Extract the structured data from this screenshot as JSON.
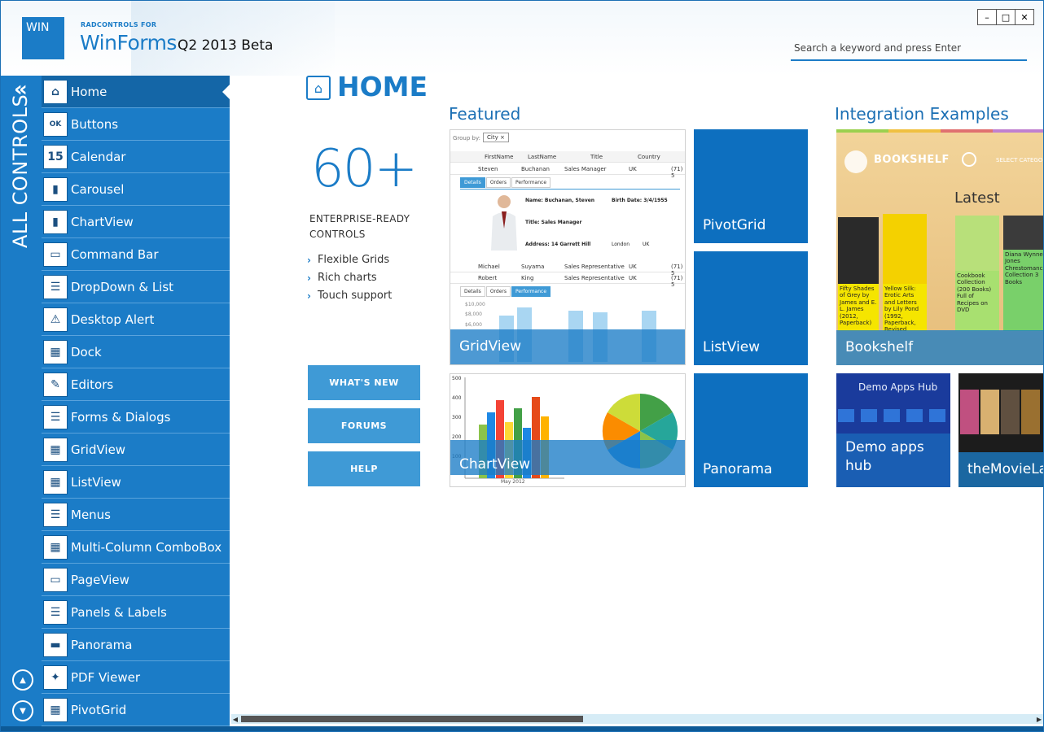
{
  "header": {
    "logo_text": "WIN",
    "brand_small": "RADCONTROLS FOR",
    "brand_product": "WinForms",
    "brand_version": "Q2 2013 Beta",
    "search_placeholder": "Search a keyword and press Enter",
    "window_buttons": {
      "minimize": "–",
      "maximize": "□",
      "close": "✕"
    }
  },
  "left_strip": {
    "collapse_glyph": "«",
    "vertical_label": "ALL CONTROLS",
    "scroll_up_glyph": "▲",
    "scroll_down_glyph": "▼"
  },
  "sidebar": {
    "items": [
      {
        "label": "Home",
        "icon": "home-icon",
        "glyph": "⌂",
        "active": true
      },
      {
        "label": "Buttons",
        "icon": "ok-button-icon",
        "glyph": "OK"
      },
      {
        "label": "Calendar",
        "icon": "calendar-icon",
        "glyph": "15"
      },
      {
        "label": "Carousel",
        "icon": "carousel-icon",
        "glyph": "▮"
      },
      {
        "label": "ChartView",
        "icon": "chart-icon",
        "glyph": "▮"
      },
      {
        "label": "Command Bar",
        "icon": "command-bar-icon",
        "glyph": "▭"
      },
      {
        "label": "DropDown & List",
        "icon": "dropdown-list-icon",
        "glyph": "☰"
      },
      {
        "label": "Desktop Alert",
        "icon": "alert-icon",
        "glyph": "⚠"
      },
      {
        "label": "Dock",
        "icon": "dock-icon",
        "glyph": "▦"
      },
      {
        "label": "Editors",
        "icon": "pencil-icon",
        "glyph": "✎"
      },
      {
        "label": "Forms & Dialogs",
        "icon": "form-icon",
        "glyph": "☰"
      },
      {
        "label": "GridView",
        "icon": "grid-icon",
        "glyph": "▦"
      },
      {
        "label": "ListView",
        "icon": "list-view-icon",
        "glyph": "▦"
      },
      {
        "label": "Menus",
        "icon": "menu-icon",
        "glyph": "☰"
      },
      {
        "label": "Multi-Column ComboBox",
        "icon": "combobox-icon",
        "glyph": "▦"
      },
      {
        "label": "PageView",
        "icon": "page-view-icon",
        "glyph": "▭"
      },
      {
        "label": "Panels & Labels",
        "icon": "panels-icon",
        "glyph": "☰"
      },
      {
        "label": "Panorama",
        "icon": "panorama-icon",
        "glyph": "▬"
      },
      {
        "label": "PDF Viewer",
        "icon": "pdf-icon",
        "glyph": "✦"
      },
      {
        "label": "PivotGrid",
        "icon": "pivot-grid-icon",
        "glyph": "▦"
      }
    ]
  },
  "main": {
    "title": "HOME",
    "big_number": "60+",
    "subhead_line1": "ENTERPRISE-READY",
    "subhead_line2": "CONTROLS",
    "features": [
      "Flexible Grids",
      "Rich charts",
      "Touch support"
    ],
    "feature_glyph": "›",
    "buttons": [
      "WHAT'S NEW",
      "FORUMS",
      "HELP"
    ],
    "featured_title": "Featured",
    "integration_title": "Integration Examples",
    "tiles": {
      "gridview": "GridView",
      "pivotgrid": "PivotGrid",
      "listview": "ListView",
      "chartview": "ChartView",
      "panorama": "Panorama",
      "bookshelf": "Bookshelf",
      "demo_apps": "Demo apps hub",
      "movielab": "theMovieLab"
    }
  },
  "grid_preview": {
    "group_by": "Group by:",
    "chip": "City ×",
    "headers": [
      "FirstName",
      "LastName",
      "Title",
      "Country"
    ],
    "row1": [
      "Steven",
      "Buchanan",
      "Sales Manager",
      "UK",
      "(71) 5"
    ],
    "tabs": [
      "Details",
      "Orders",
      "Performance"
    ],
    "detail_name": "Name: Buchanan, Steven",
    "detail_birth": "Birth Date: 3/4/1955",
    "detail_title": "Title: Sales Manager",
    "detail_address": "Address: 14 Garrett Hill",
    "detail_city": "London",
    "detail_country": "UK",
    "row2": [
      "Michael",
      "Suyama",
      "Sales Representative",
      "UK",
      "(71) 5"
    ],
    "row3": [
      "Robert",
      "King",
      "Sales Representative",
      "UK",
      "(71) 5"
    ],
    "chart_ticks": [
      "$10,000",
      "$8,000",
      "$6,000"
    ]
  },
  "chart_preview": {
    "y_ticks": [
      "500",
      "400",
      "300",
      "200",
      "100"
    ],
    "x_label": "May 2012"
  },
  "bookshelf_preview": {
    "name": "BOOKSHELF",
    "category": "SELECT CATEGORY",
    "latest": "Latest",
    "books": [
      "Fifty Shades of Grey by James and E. L. James (2012, Paperback)",
      "Yellow Silk: Erotic Arts and Letters by Lily Pond (1992, Paperback, Revised",
      "Cookbook Collection (200 Books) Full of Recipes on DVD",
      "Diana Wynne Jones Chrestomanci Collection 3 Books"
    ]
  },
  "demo_preview": {
    "top_label": "Demo Apps Hub"
  },
  "colors": {
    "accent": "#1b7cc7",
    "sidebar": "#1b7cc7",
    "tile": "#0d6fbf",
    "link_button": "#3f9ad6"
  }
}
